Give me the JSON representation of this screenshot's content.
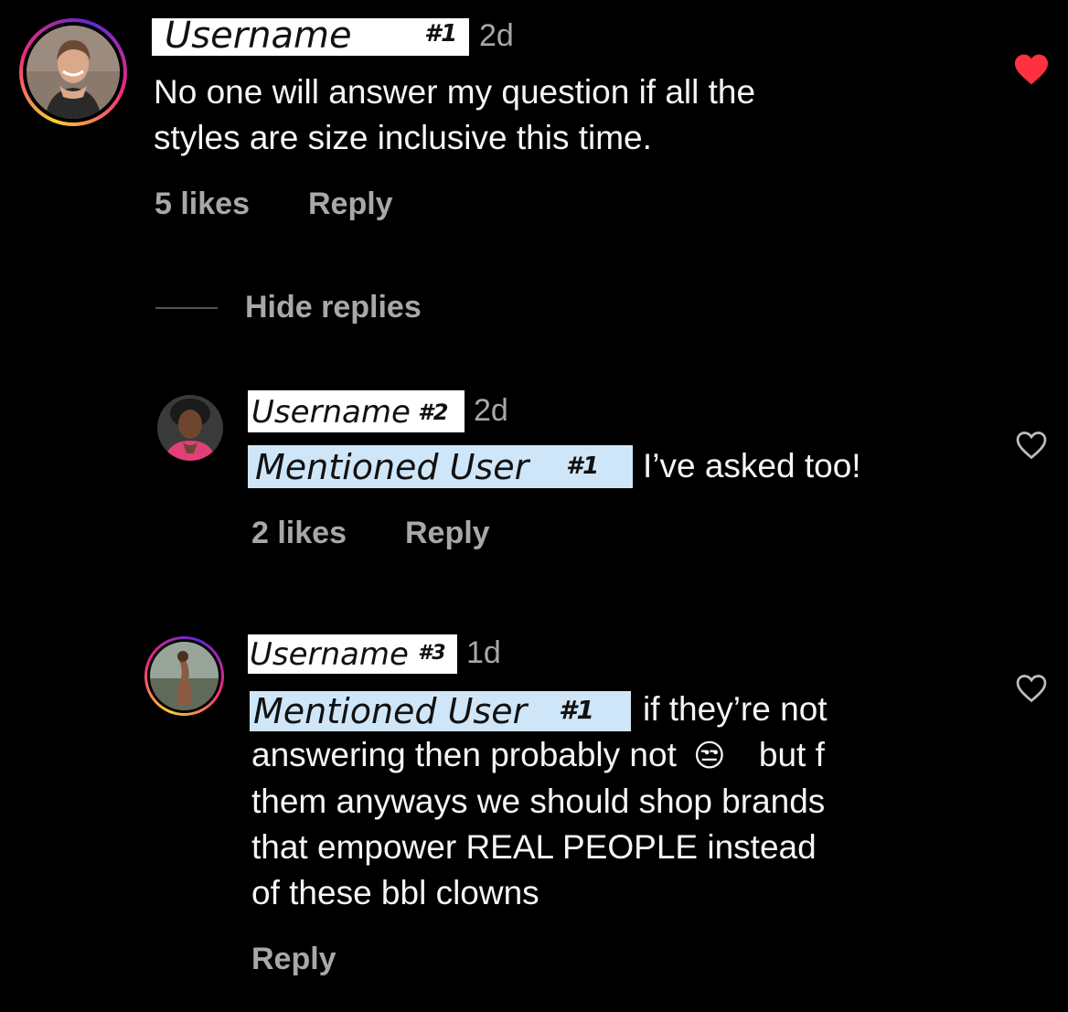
{
  "comment_main": {
    "username": "Username",
    "user_number": "#1",
    "time": "2d",
    "text_line1": "No one will answer my question if all the",
    "text_line2": "styles are size inclusive this time.",
    "likes": "5 likes",
    "reply": "Reply",
    "liked": true
  },
  "hide_replies": "Hide replies",
  "reply_1": {
    "username": "Username",
    "user_number": "#2",
    "time": "2d",
    "mention": "Mentioned User",
    "mention_number": "#1",
    "text": "I’ve asked too!",
    "likes": "2 likes",
    "reply": "Reply",
    "liked": false
  },
  "reply_2": {
    "username": "Username",
    "user_number": "#3",
    "time": "1d",
    "mention": "Mentioned User",
    "mention_number": "#1",
    "text_line1": "if they’re not",
    "text_line2a": "answering then probably not",
    "emoji": "😒",
    "text_line2b": "but f",
    "text_line3": "them anyways we should shop brands",
    "text_line4": "that empower REAL PEOPLE instead",
    "text_line5": "of these bbl clowns",
    "reply": "Reply",
    "liked": false
  },
  "colors": {
    "background": "#000000",
    "text_primary": "#f5f5f5",
    "text_secondary": "#a8a8a8",
    "like_red": "#ff3040",
    "mention_highlight": "#cfe6f8"
  }
}
